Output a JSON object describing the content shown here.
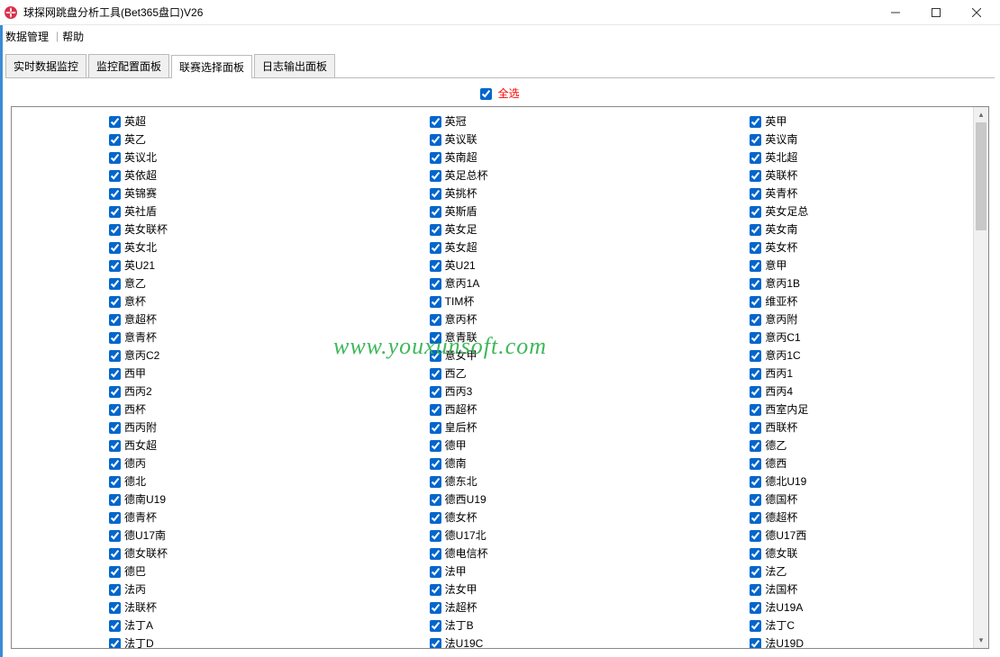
{
  "window": {
    "title": "球探网跳盘分析工具(Bet365盘口)V26",
    "minimize": "—",
    "maximize": "□",
    "close": "✕"
  },
  "menu": {
    "data_manage": "数据管理",
    "help": "帮助"
  },
  "tabs": [
    {
      "label": "实时数据监控",
      "active": false
    },
    {
      "label": "监控配置面板",
      "active": false
    },
    {
      "label": "联赛选择面板",
      "active": true
    },
    {
      "label": "日志输出面板",
      "active": false
    }
  ],
  "select_all": {
    "label": "全选",
    "checked": true
  },
  "columns": [
    [
      "英超",
      "英乙",
      "英议北",
      "英依超",
      "英锦赛",
      "英社盾",
      "英女联杯",
      "英女北",
      "英U21",
      "意乙",
      "意杯",
      "意超杯",
      "意青杯",
      "意丙C2",
      "西甲",
      "西丙2",
      "西杯",
      "西丙附",
      "西女超",
      "德丙",
      "德北",
      "德南U19",
      "德青杯",
      "德U17南",
      "德女联杯",
      "德巴",
      "法丙",
      "法联杯",
      "法丁A",
      "法丁D"
    ],
    [
      "英冠",
      "英议联",
      "英南超",
      "英足总杯",
      "英挑杯",
      "英斯盾",
      "英女足",
      "英女超",
      "英U21",
      "意丙1A",
      "TIM杯",
      "意丙杯",
      "意青联",
      "意女甲",
      "西乙",
      "西丙3",
      "西超杯",
      "皇后杯",
      "德甲",
      "德南",
      "德东北",
      "德西U19",
      "德女杯",
      "德U17北",
      "德电信杯",
      "法甲",
      "法女甲",
      "法超杯",
      "法丁B",
      "法U19C"
    ],
    [
      "英甲",
      "英议南",
      "英北超",
      "英联杯",
      "英青杯",
      "英女足总",
      "英女南",
      "英女杯",
      "意甲",
      "意丙1B",
      "维亚杯",
      "意丙附",
      "意丙C1",
      "意丙1C",
      "西丙1",
      "西丙4",
      "西室内足",
      "西联杯",
      "德乙",
      "德西",
      "德北U19",
      "德国杯",
      "德超杯",
      "德U17西",
      "德女联",
      "法乙",
      "法国杯",
      "法U19A",
      "法丁C",
      "法U19D"
    ]
  ],
  "watermark": "www.youxunsoft.com"
}
